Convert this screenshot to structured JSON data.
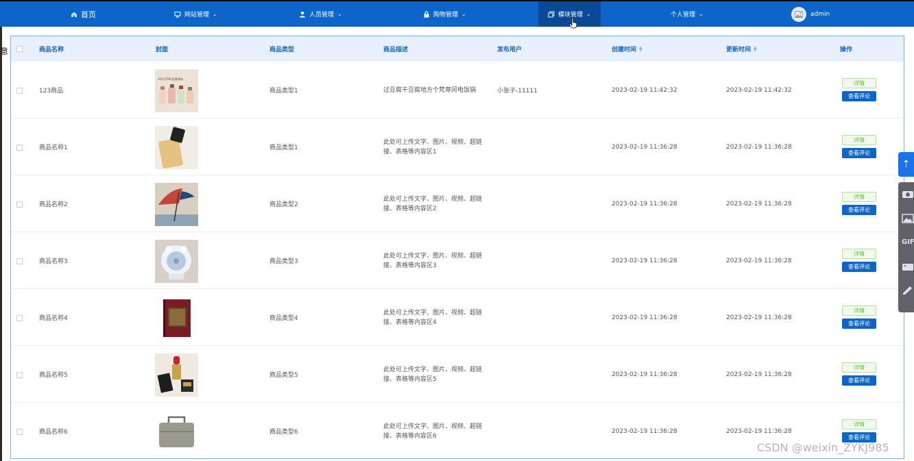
{
  "nav": {
    "home": "首页",
    "site_mgmt": "网站管理",
    "user_mgmt": "人员管理",
    "shop_mgmt": "购物管理",
    "block_mgmt": "模块管理",
    "personal_mgmt": "个人管理",
    "username": "admin"
  },
  "left_edge_text": "意",
  "table": {
    "headers": {
      "name": "商品名称",
      "cover": "封面",
      "type": "商品类型",
      "desc": "商品描述",
      "publisher": "发布用户",
      "created": "创建时间",
      "updated": "更新时间",
      "actions": "操作"
    },
    "detail_label": "详情",
    "comment_label": "查看评论",
    "rows": [
      {
        "name": "123商品",
        "type": "商品类型1",
        "desc": "过豆腐干豆腐地方个梵蒂冈电饭锅",
        "publisher": "小张子-11111",
        "created": "2023-02-19 11:42:32",
        "updated": "2023-02-19 11:42:32",
        "cover": "cosmetic-bottles",
        "cover_text": "30分子FNY自营商场"
      },
      {
        "name": "商品名称1",
        "type": "商品类型1",
        "desc": "此处可上传文字、图片、视频、超链接、表格等内容区1",
        "publisher": "",
        "created": "2023-02-19 11:36:28",
        "updated": "2023-02-19 11:36:28",
        "cover": "foundation-bottle"
      },
      {
        "name": "商品名称2",
        "type": "商品类型2",
        "desc": "此处可上传文字、图片、视频、超链接、表格等内容区2",
        "publisher": "",
        "created": "2023-02-19 11:36:28",
        "updated": "2023-02-19 11:36:28",
        "cover": "umbrella"
      },
      {
        "name": "商品名称3",
        "type": "商品类型3",
        "desc": "此处可上传文字、图片、视频、超链接、表格等内容区3",
        "publisher": "",
        "created": "2023-02-19 11:36:28",
        "updated": "2023-02-19 11:36:28",
        "cover": "desk-fan"
      },
      {
        "name": "商品名称4",
        "type": "商品类型4",
        "desc": "此处可上传文字、图片、视频、超链接、表格等内容区4",
        "publisher": "",
        "created": "2023-02-19 11:36:28",
        "updated": "2023-02-19 11:36:28",
        "cover": "book"
      },
      {
        "name": "商品名称5",
        "type": "商品类型5",
        "desc": "此处可上传文字、图片、视频、超链接、表格等内容区5",
        "publisher": "",
        "created": "2023-02-19 11:36:28",
        "updated": "2023-02-19 11:36:28",
        "cover": "lipstick"
      },
      {
        "name": "商品名称6",
        "type": "商品类型6",
        "desc": "此处可上传文字、图片、视频、超链接、表格等内容区6",
        "publisher": "",
        "created": "2023-02-19 11:36:28",
        "updated": "2023-02-19 11:36:28",
        "cover": "bag"
      }
    ]
  },
  "float_tools": {
    "gif_label": "GIF"
  },
  "watermark": "CSDN @weixin_ZYKJ985",
  "colors": {
    "nav_bg": "#0d65c9",
    "nav_active": "#084a98",
    "header_text": "#1565c0",
    "detail_green": "#67c23a",
    "comment_blue": "#0d65c9"
  }
}
